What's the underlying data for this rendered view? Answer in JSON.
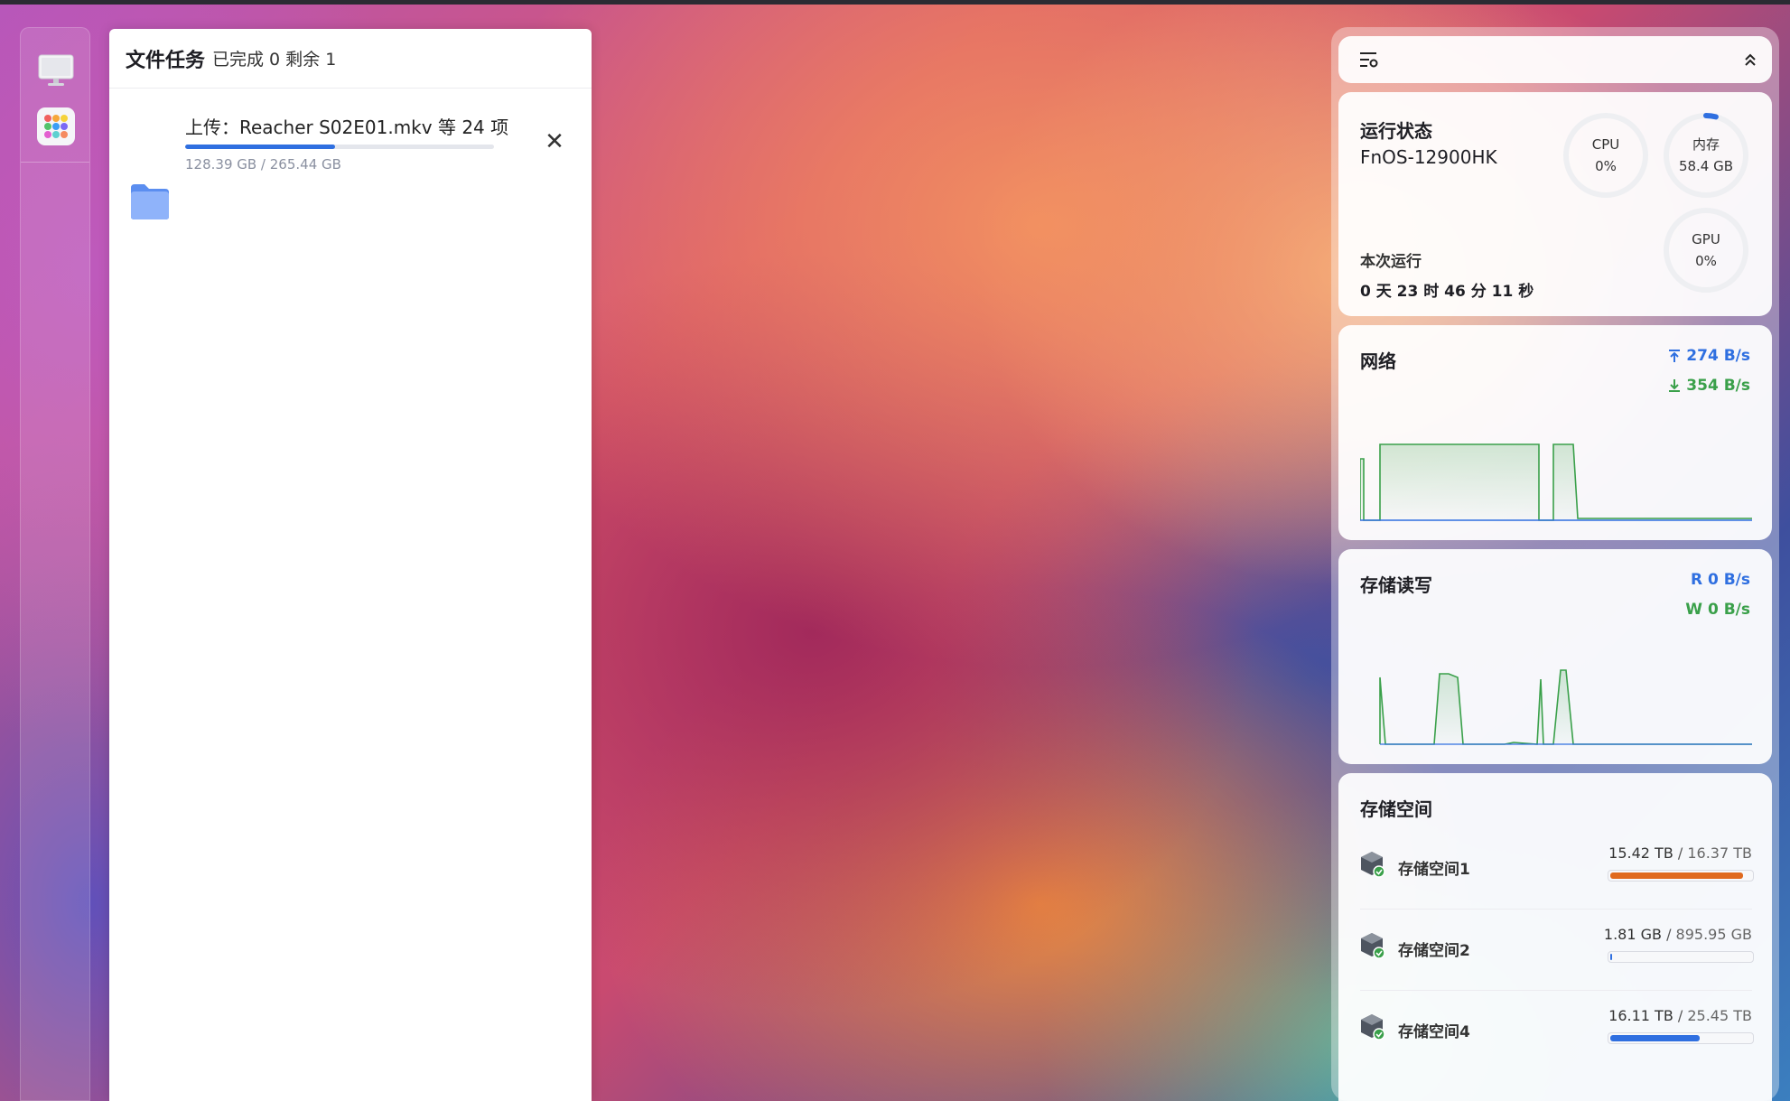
{
  "dock": {
    "items": [
      {
        "name": "desktop",
        "icon": "monitor-icon"
      },
      {
        "name": "app-center",
        "icon": "app-grid-icon"
      }
    ]
  },
  "file_tasks": {
    "title": "文件任务",
    "stats": "已完成 0 剩余 1",
    "items": [
      {
        "name": "上传：Reacher S02E01.mkv 等 24 项",
        "size": "128.39 GB / 265.44 GB",
        "progress": 0.484,
        "close_label": "✕"
      }
    ]
  },
  "widgets": {
    "status": {
      "title": "运行状态",
      "host": "FnOS-12900HK",
      "uptime_label": "本次运行",
      "uptime": "0 天 23 时 46 分 11 秒",
      "cpu": {
        "label": "CPU",
        "value": "0%",
        "fraction": 0
      },
      "memory": {
        "label": "内存",
        "value": "58.4 GB",
        "fraction": 0.04
      },
      "gpu": {
        "label": "GPU",
        "value": "0%",
        "fraction": 0
      }
    },
    "network": {
      "title": "网络",
      "upload": "274 B/s",
      "download": "354 B/s"
    },
    "storage_io": {
      "title": "存储读写",
      "read": "R  0 B/s",
      "write": "W  0 B/s"
    },
    "storage_space": {
      "title": "存储空间",
      "items": [
        {
          "name": "存储空间1",
          "used": "15.42 TB",
          "total": "16.37 TB",
          "fraction": 0.942,
          "color": "#e06a1e"
        },
        {
          "name": "存储空间2",
          "used": "1.81 GB",
          "total": "895.95 GB",
          "fraction": 0.002,
          "color": "#2f6fe0"
        },
        {
          "name": "存储空间4",
          "used": "16.11 TB",
          "total": "25.45 TB",
          "fraction": 0.633,
          "color": "#2f6fe0"
        }
      ]
    }
  },
  "colors": {
    "accent": "#2f6fe0",
    "upload": "#2f6fe0",
    "download": "#3aa04a",
    "warning": "#e06a1e"
  }
}
